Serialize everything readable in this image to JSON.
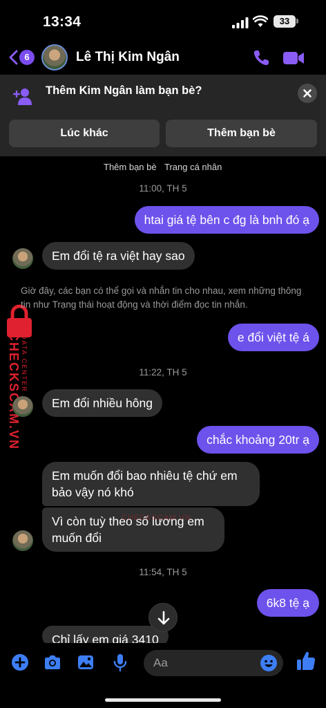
{
  "status_bar": {
    "time": "13:34",
    "battery": "33"
  },
  "header": {
    "back_count": "6",
    "contact_name": "Lê Thị Kim Ngân"
  },
  "friend_banner": {
    "prompt": "Thêm Kim Ngân làm bạn bè?",
    "later_label": "Lúc khác",
    "add_label": "Thêm bạn bè"
  },
  "under_banner": {
    "add_friend_label": "Thêm bạn bè",
    "profile_label": "Trang cá nhân"
  },
  "messages": {
    "ts1": "11:00, TH 5",
    "m1": "htai giá tệ bên c đg là bnh đó ạ",
    "m2": "Em đổi tệ ra việt hay sao",
    "notice": "Giờ đây, các bạn có thể gọi và nhắn tin cho nhau, xem những thông tin như Trạng thái hoạt động và thời điểm đọc tin nhắn.",
    "m3": "e đổi việt tệ á",
    "ts2": "11:22, TH 5",
    "m4": "Em đổi nhiều hông",
    "m5": "chắc khoảng 20tr ạ",
    "m6": "Em muốn đổi bao nhiêu tệ chứ em bảo vậy nó khó",
    "m7": "Vì còn tuỳ theo số lương em muốn đổi",
    "ts3": "11:54, TH 5",
    "m8": "6k8 tệ ạ",
    "m9": "Chỉ lấy em giá 3410"
  },
  "watermark": {
    "brand": "CHECKSCAM.VN",
    "tagline": "DATA CENTER"
  },
  "composer": {
    "placeholder": "Aa"
  },
  "colors": {
    "sent_bubble": "#6e52ec",
    "received_bubble": "#303030",
    "accent": "#8a5cf6",
    "icon_blue": "#3d7ef5"
  }
}
